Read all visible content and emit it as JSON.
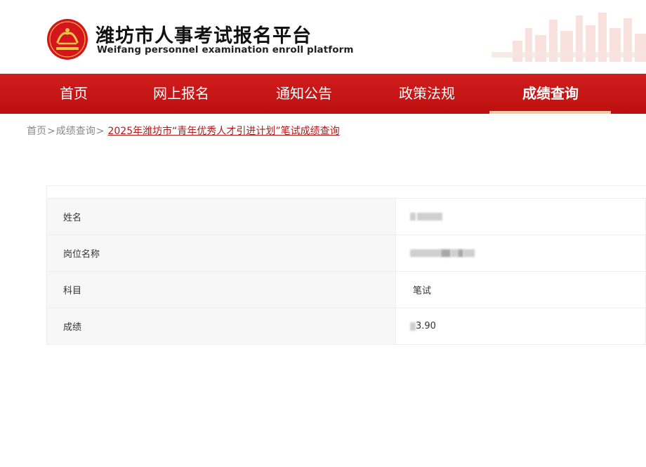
{
  "header": {
    "title": "潍坊市人事考试报名平台",
    "subtitle": "Weifang personnel examination enroll platform",
    "brand_color": "#c8161d"
  },
  "nav": {
    "items": [
      {
        "label": "首页",
        "active": false
      },
      {
        "label": "网上报名",
        "active": false
      },
      {
        "label": "通知公告",
        "active": false
      },
      {
        "label": "政策法规",
        "active": false
      },
      {
        "label": "成绩查询",
        "active": true
      }
    ],
    "active_color": "#f6c7a4"
  },
  "breadcrumb": {
    "home": "首页",
    "section": "成绩查询",
    "separator": ">",
    "current": "2025年潍坊市“青年优秀人才引进计划”笔试成绩查询"
  },
  "result": {
    "rows": [
      {
        "label": "姓名",
        "value": ""
      },
      {
        "label": "岗位名称",
        "value": ""
      },
      {
        "label": "科目",
        "value": "笔试"
      },
      {
        "label": "成绩",
        "value": "3.90"
      }
    ]
  }
}
